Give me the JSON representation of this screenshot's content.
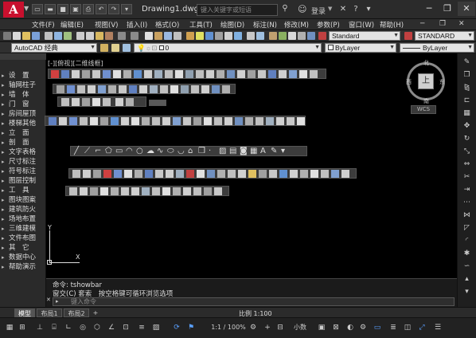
{
  "titlebar": {
    "logo": "A",
    "document_title": "Drawing1.dwg",
    "search_placeholder": "键入关键字或短语",
    "login": "登录"
  },
  "menubar": {
    "items": [
      "文件(F)",
      "编辑(E)",
      "视图(V)",
      "插入(I)",
      "格式(O)",
      "工具(T)",
      "绘图(D)",
      "标注(N)",
      "修改(M)",
      "参数(P)",
      "窗口(W)",
      "帮助(H)"
    ]
  },
  "toolbar1": {
    "text_style": "Standard",
    "dim_style": "STANDARD"
  },
  "toolbar2": {
    "workspace": "AutoCAD 经典",
    "layer": "0",
    "color": "ByLayer",
    "linetype": "ByLayer"
  },
  "left_panel": {
    "items": [
      "设　置",
      "轴网柱子",
      "墙　体",
      "门　窗",
      "房间屋顶",
      "楼梯其他",
      "立　面",
      "剖　面",
      "文字表格",
      "尺寸标注",
      "符号标注",
      "图层控制",
      "工　具",
      "图块图案",
      "建筑防火",
      "场地布置",
      "三维建模",
      "文件布图",
      "其　它",
      "数据中心",
      "帮助演示"
    ]
  },
  "canvas": {
    "viewport_label": "[-][俯视][二维线框]"
  },
  "viewcube": {
    "top": "上",
    "north": "北",
    "south": "南",
    "east": "东",
    "west": "西",
    "wcs": "WCS"
  },
  "ucs": {
    "x": "X",
    "y": "Y"
  },
  "command": {
    "line1": "命令: tshowbar",
    "line2": "窗交(C) 套索　按空格键可循环浏览选项",
    "input_placeholder": "键入命令"
  },
  "layout_tabs": [
    "模型",
    "布局1",
    "布局2",
    "+"
  ],
  "status": {
    "scale": "比例 1:100",
    "annotation_scale": "1:1 / 100%",
    "units": "小数"
  }
}
